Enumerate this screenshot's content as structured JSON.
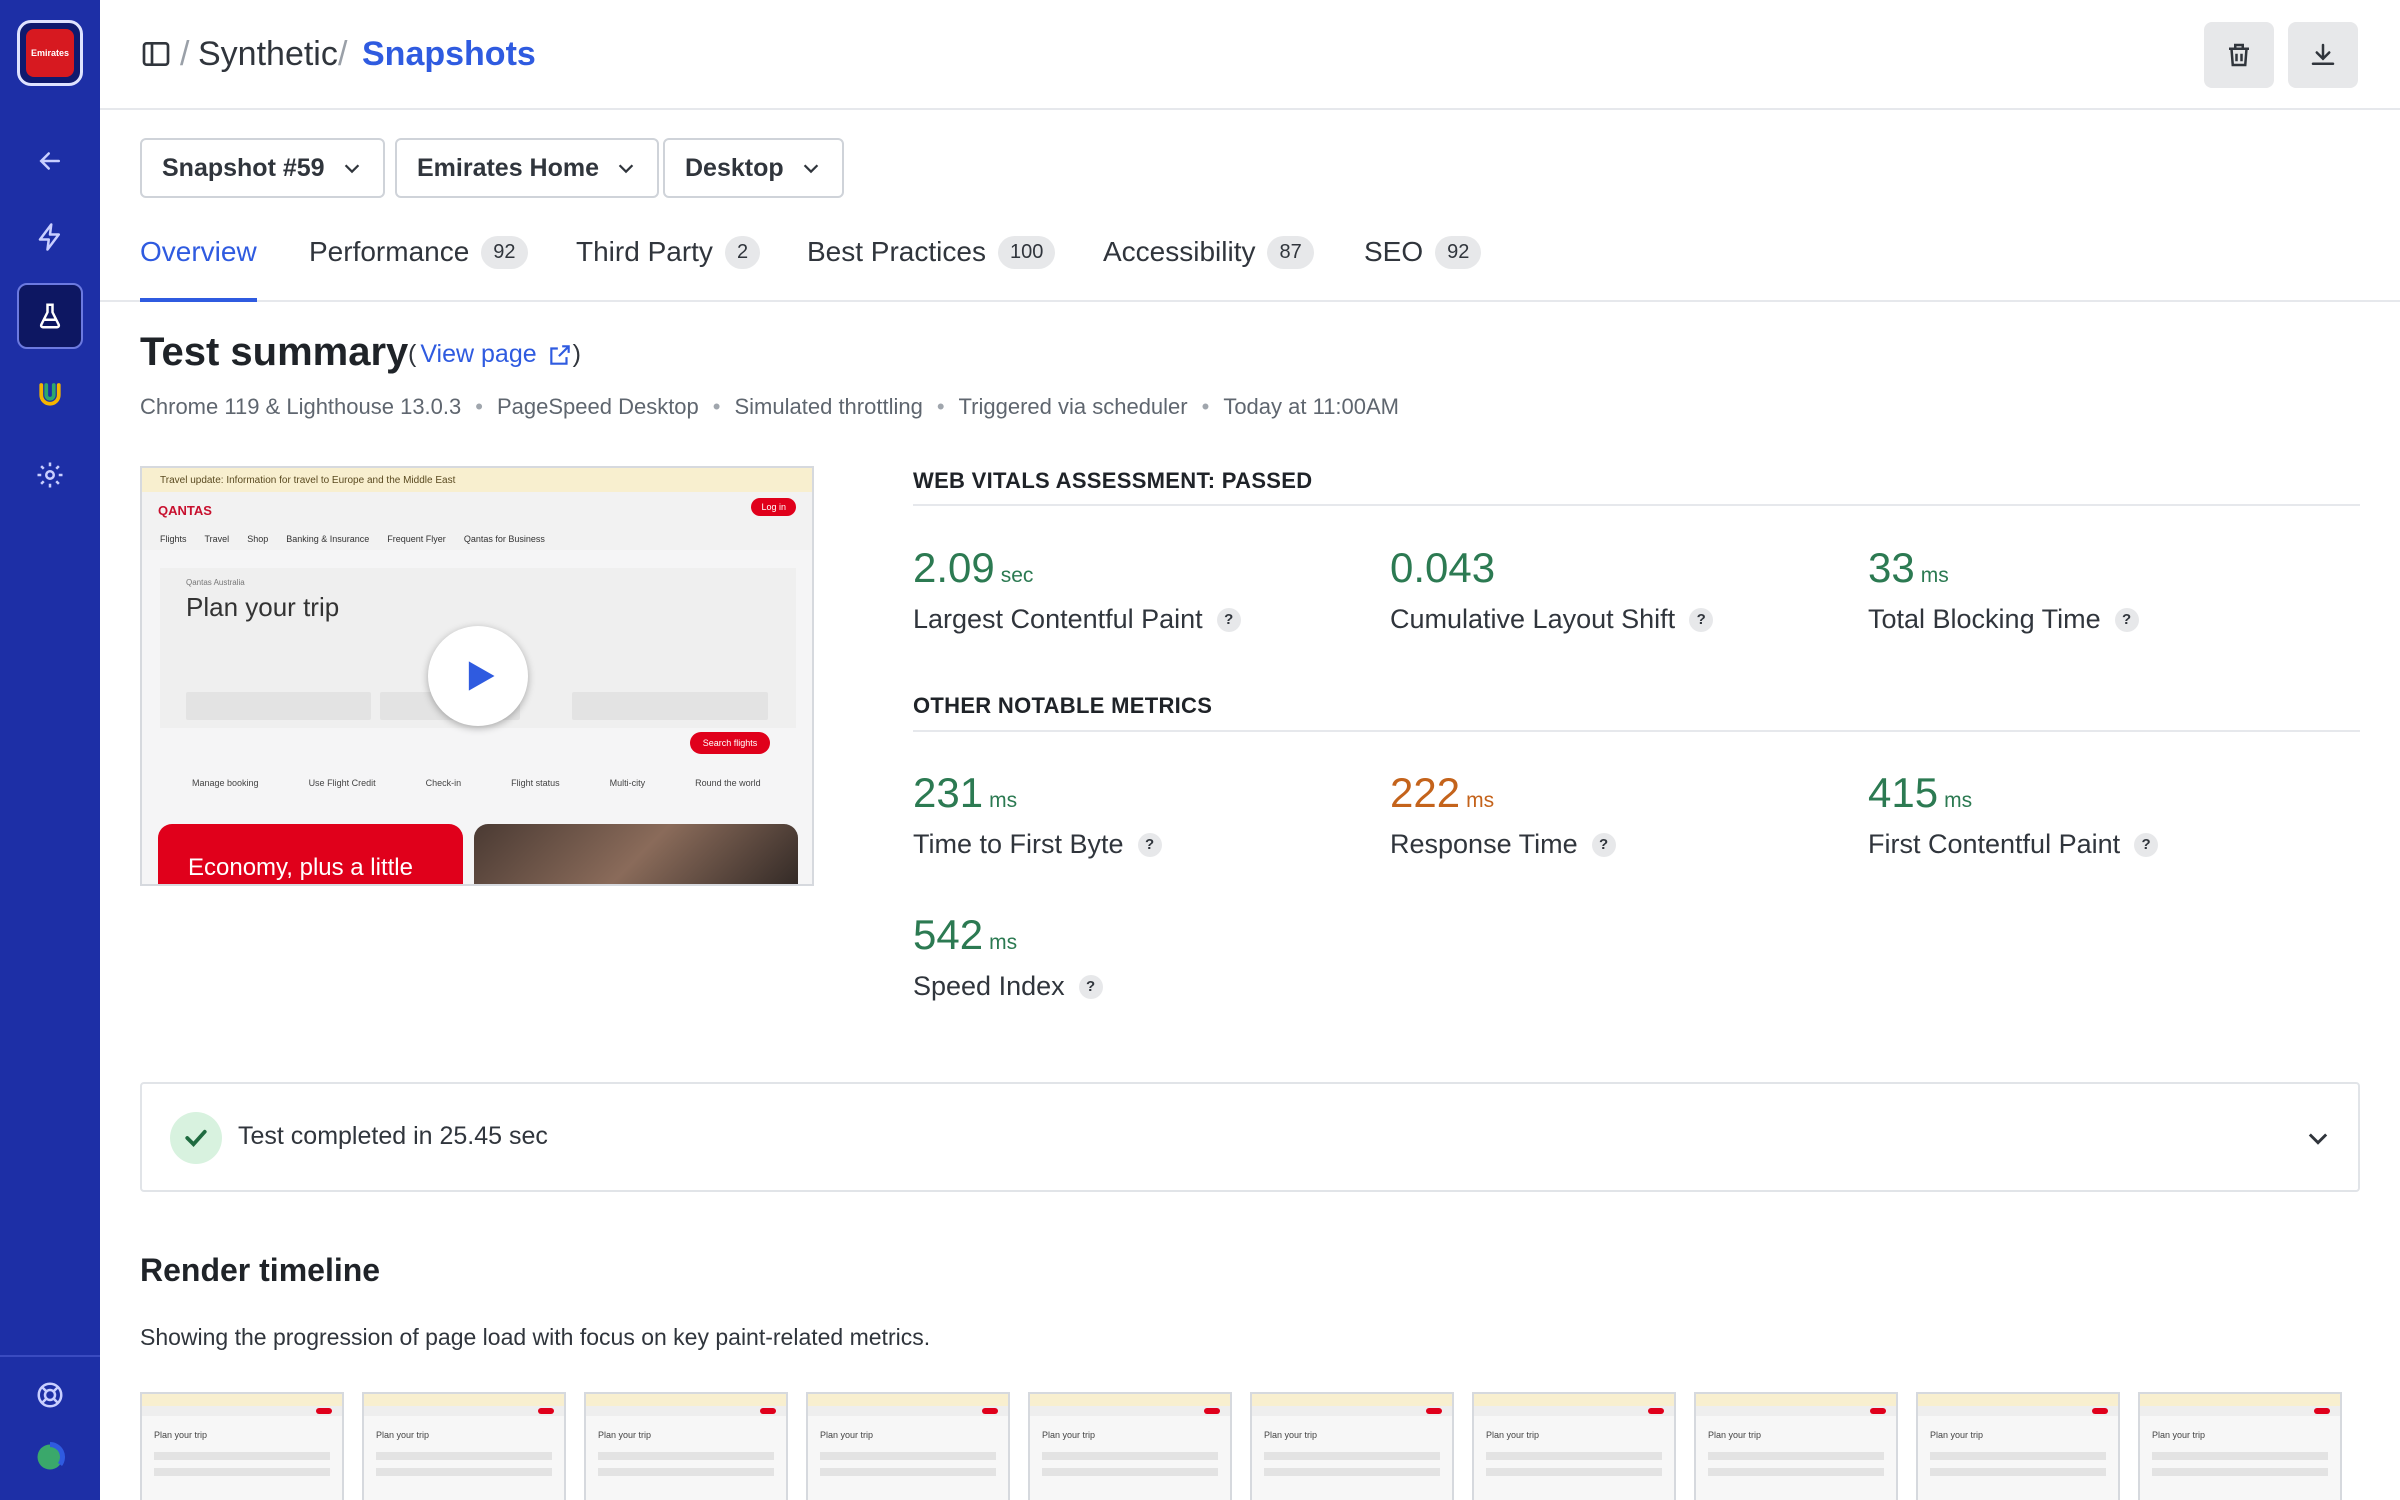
{
  "sidebar": {
    "logo_text": "Emirates",
    "nav": [
      "back-arrow-icon",
      "lightning-icon",
      "flask-icon",
      "rainbow-logo-icon",
      "gear-icon"
    ],
    "bottom": [
      "help-lifebuoy-icon",
      "user-avatar"
    ]
  },
  "header": {
    "breadcrumb_root": "Synthetic",
    "breadcrumb_sep": "/",
    "breadcrumb_current": "Snapshots"
  },
  "filters": {
    "snapshot": "Snapshot #59",
    "page": "Emirates Home",
    "device": "Desktop"
  },
  "tabs": [
    {
      "label": "Overview",
      "count": ""
    },
    {
      "label": "Performance",
      "count": "92"
    },
    {
      "label": "Third Party",
      "count": "2"
    },
    {
      "label": "Best Practices",
      "count": "100"
    },
    {
      "label": "Accessibility",
      "count": "87"
    },
    {
      "label": "SEO",
      "count": "92"
    }
  ],
  "summary": {
    "title": "Test summary",
    "view_page": "View page",
    "meta": [
      "Chrome 119 & Lighthouse 13.0.3",
      "PageSpeed Desktop",
      "Simulated throttling",
      "Triggered via scheduler",
      "Today at 11:00AM"
    ]
  },
  "preview": {
    "banner": "Travel update: Information for travel to Europe and the Middle East",
    "brand": "QANTAS",
    "login": "Log in",
    "nav": [
      "Flights",
      "Travel",
      "Shop",
      "Banking & Insurance",
      "Frequent Flyer",
      "Qantas for Business"
    ],
    "small": "Qantas Australia",
    "heading": "Plan your trip",
    "search_btn": "Search flights",
    "links": [
      "Manage booking",
      "Use Flight Credit",
      "Check-in",
      "Flight status",
      "Multi-city",
      "Round the world"
    ],
    "promo": "Economy, plus a little"
  },
  "web_vitals": {
    "label": "WEB VITALS ASSESSMENT: PASSED",
    "metrics": [
      {
        "value": "2.09",
        "unit": "sec",
        "name": "Largest Contentful Paint",
        "status": "good"
      },
      {
        "value": "0.043",
        "unit": "",
        "name": "Cumulative Layout Shift",
        "status": "good"
      },
      {
        "value": "33",
        "unit": "ms",
        "name": "Total Blocking Time",
        "status": "good"
      }
    ]
  },
  "other_metrics": {
    "label": "OTHER NOTABLE METRICS",
    "metrics": [
      {
        "value": "231",
        "unit": "ms",
        "name": "Time to First Byte",
        "status": "good"
      },
      {
        "value": "222",
        "unit": "ms",
        "name": "Response Time",
        "status": "warn"
      },
      {
        "value": "415",
        "unit": "ms",
        "name": "First Contentful Paint",
        "status": "good"
      },
      {
        "value": "542",
        "unit": "ms",
        "name": "Speed Index",
        "status": "good"
      }
    ]
  },
  "help_glyph": "?",
  "completion": {
    "text": "Test completed in 25.45 sec"
  },
  "render_timeline": {
    "title": "Render timeline",
    "description": "Showing the progression of page load with focus on key paint-related metrics.",
    "frame_heading": "Plan your trip",
    "frame_count": 10
  },
  "colors": {
    "sidebar": "#1d2fa6",
    "accent": "#2f5be0",
    "good": "#2c7a52",
    "warn": "#c4631b"
  }
}
